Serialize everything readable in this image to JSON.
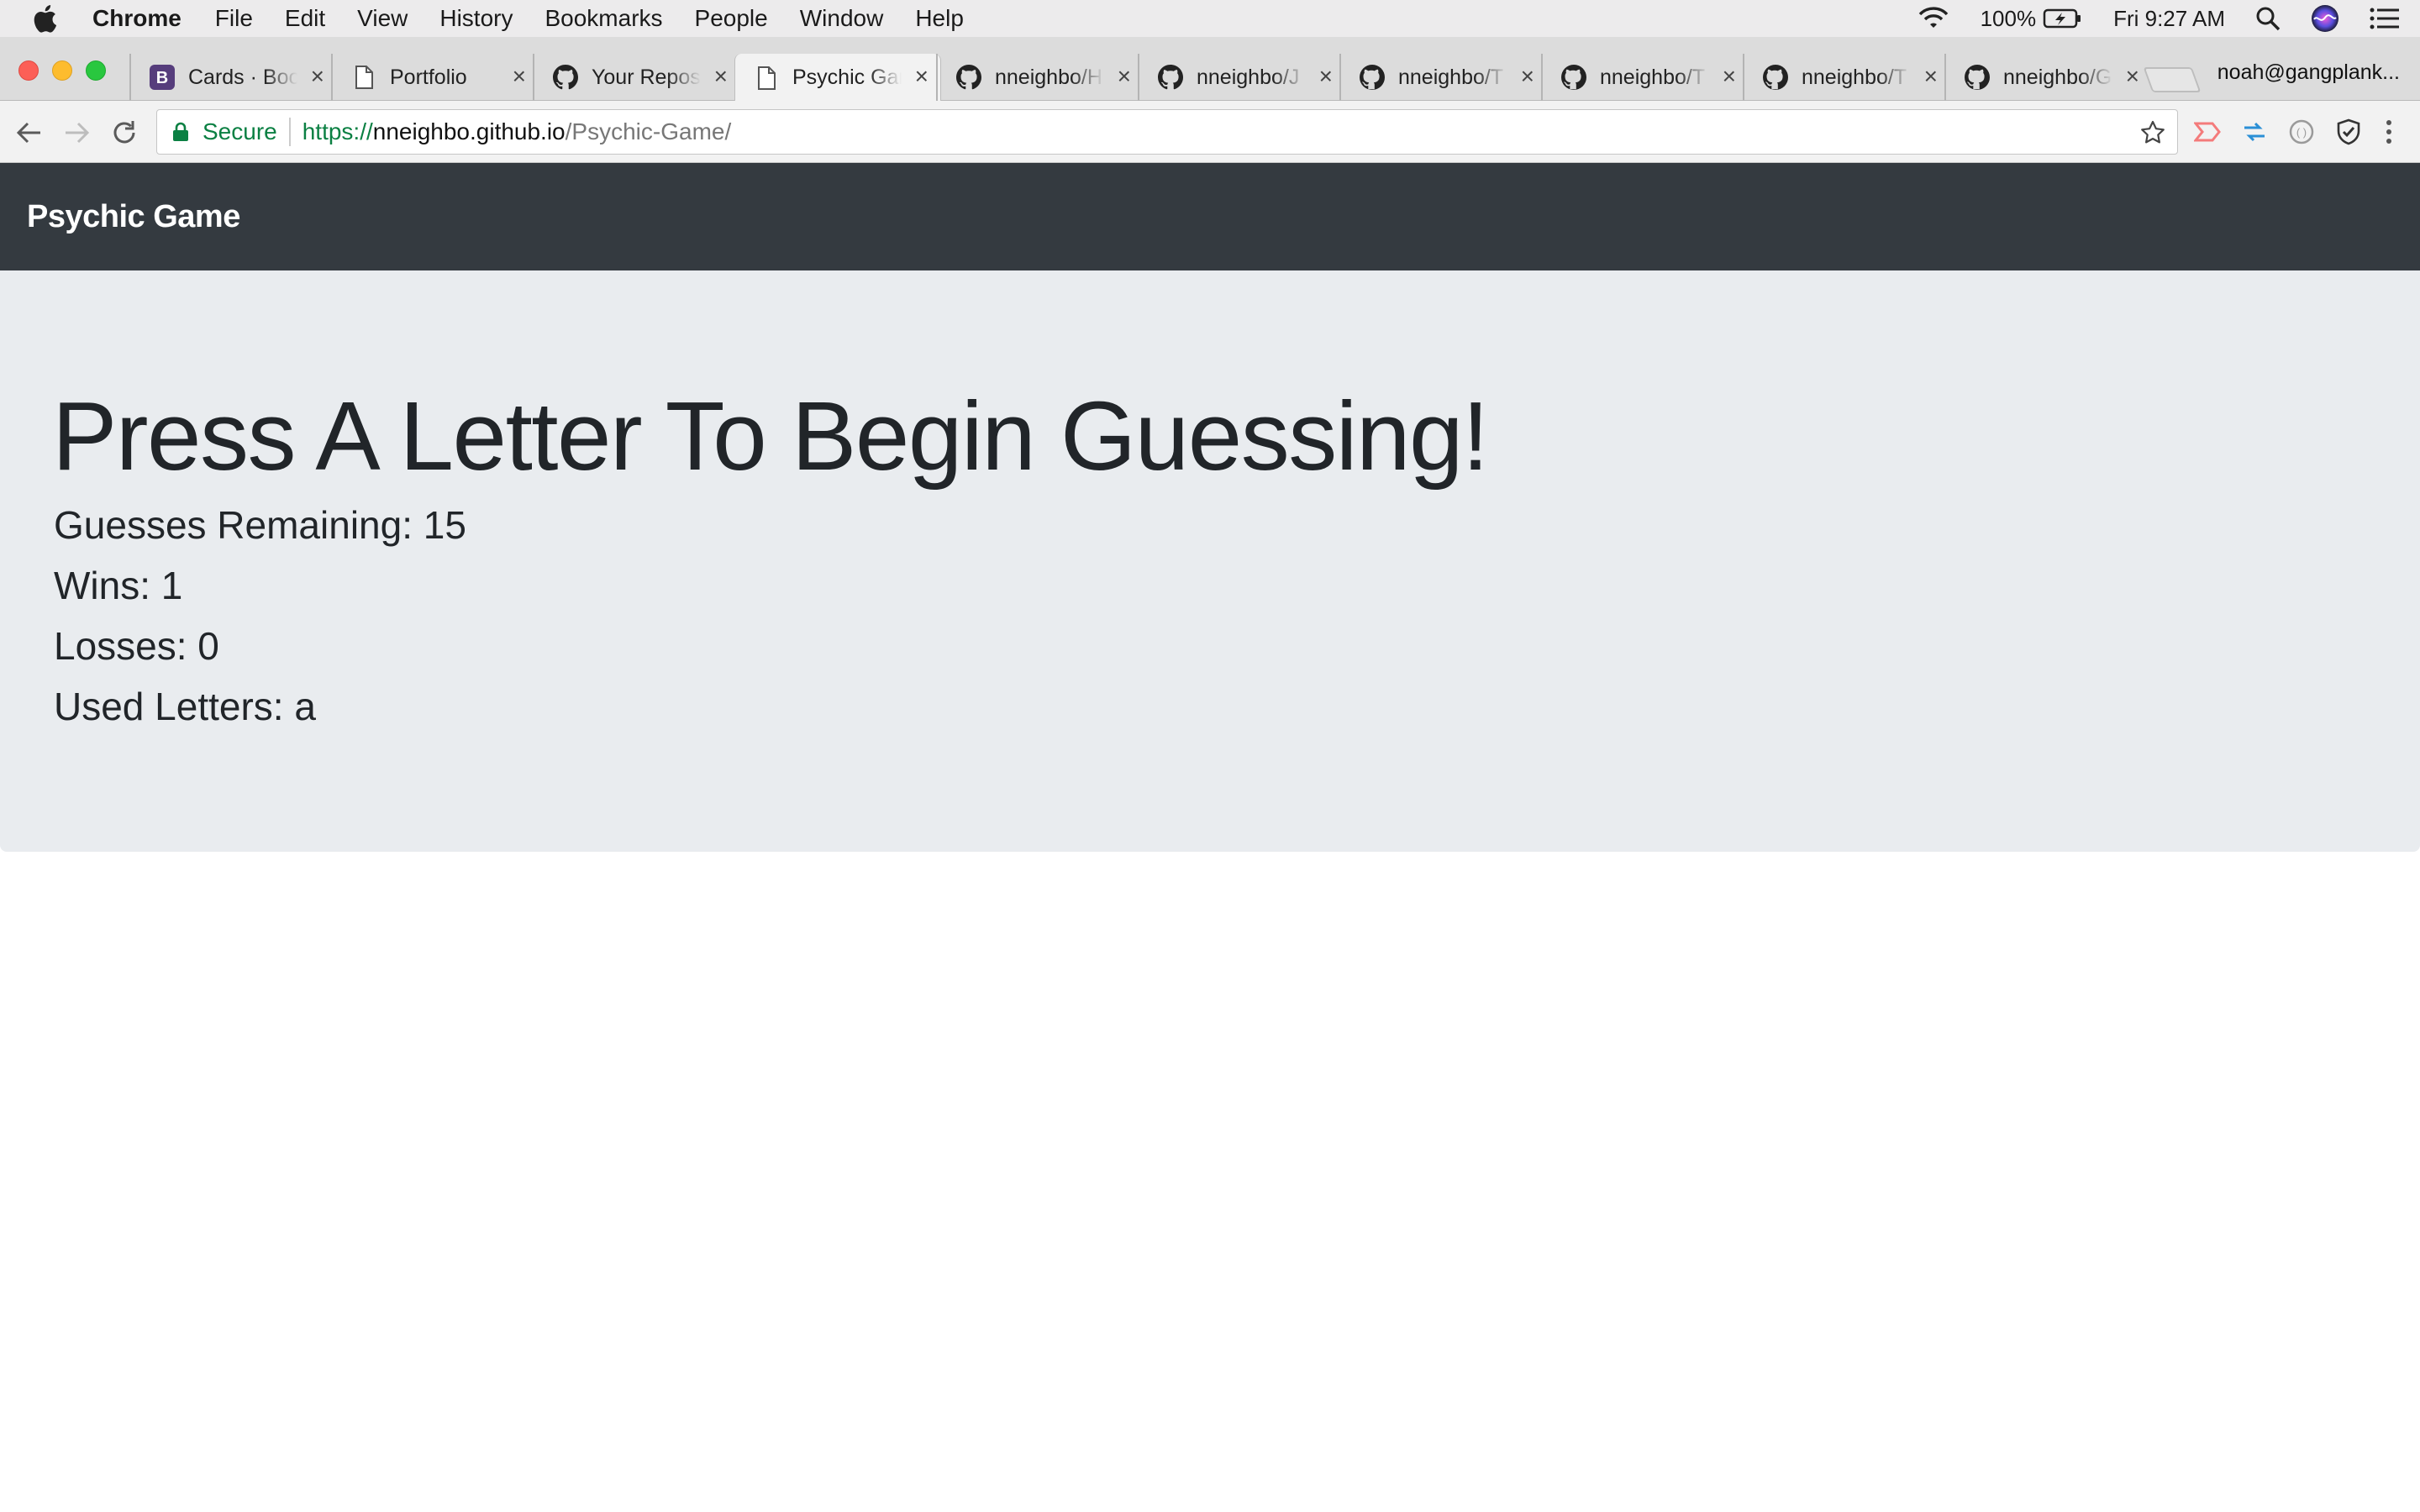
{
  "menubar": {
    "app": "Chrome",
    "items": [
      "File",
      "Edit",
      "View",
      "History",
      "Bookmarks",
      "People",
      "Window",
      "Help"
    ],
    "battery": "100%",
    "clock": "Fri 9:27 AM",
    "icons": [
      "apple-icon",
      "wifi-icon",
      "battery-icon",
      "spotlight-icon",
      "siri-icon",
      "notification-center-icon"
    ]
  },
  "browser": {
    "tabs": [
      {
        "title": "Cards · Boo",
        "favicon": "bootstrap-icon"
      },
      {
        "title": "Portfolio",
        "favicon": "page-icon"
      },
      {
        "title": "Your Repos",
        "favicon": "github-icon"
      },
      {
        "title": "Psychic Gar",
        "favicon": "page-icon",
        "active": true
      },
      {
        "title": "nneighbo/H",
        "favicon": "github-icon"
      },
      {
        "title": "nneighbo/J",
        "favicon": "github-icon"
      },
      {
        "title": "nneighbo/T",
        "favicon": "github-icon"
      },
      {
        "title": "nneighbo/T",
        "favicon": "github-icon"
      },
      {
        "title": "nneighbo/T",
        "favicon": "github-icon"
      },
      {
        "title": "nneighbo/G",
        "favicon": "github-icon"
      }
    ],
    "close_glyph": "×",
    "profile": "noah@gangplank...",
    "omnibox": {
      "security_label": "Secure",
      "scheme": "https://",
      "host": "nneighbo.github.io",
      "path": "/Psychic-Game/"
    }
  },
  "page": {
    "brand": "Psychic Game",
    "headline": "Press A Letter To Begin Guessing!",
    "guesses_remaining": "Guesses Remaining: 15",
    "wins": "Wins: 1",
    "losses": "Losses: 0",
    "used_letters": "Used Letters: a",
    "colors": {
      "navbar_bg": "#343a40",
      "jumbotron_bg": "#e9ecef",
      "text": "#212529",
      "secure_green": "#0b8043"
    }
  }
}
